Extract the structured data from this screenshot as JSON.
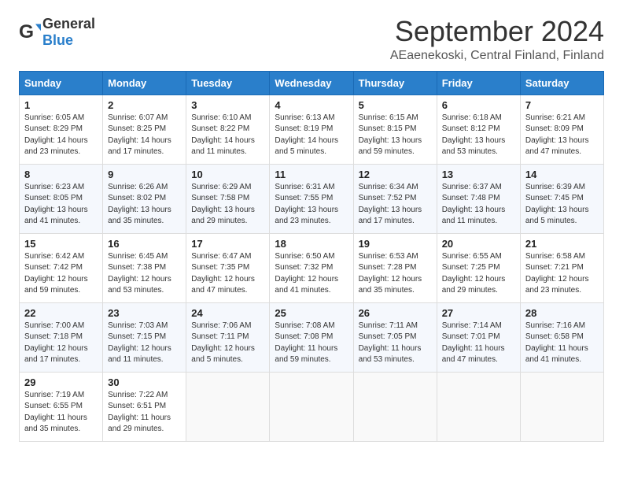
{
  "logo": {
    "text_general": "General",
    "text_blue": "Blue"
  },
  "title": "September 2024",
  "subtitle": "AEaenekoski, Central Finland, Finland",
  "days_of_week": [
    "Sunday",
    "Monday",
    "Tuesday",
    "Wednesday",
    "Thursday",
    "Friday",
    "Saturday"
  ],
  "weeks": [
    [
      {
        "day": "1",
        "sunrise": "Sunrise: 6:05 AM",
        "sunset": "Sunset: 8:29 PM",
        "daylight": "Daylight: 14 hours and 23 minutes."
      },
      {
        "day": "2",
        "sunrise": "Sunrise: 6:07 AM",
        "sunset": "Sunset: 8:25 PM",
        "daylight": "Daylight: 14 hours and 17 minutes."
      },
      {
        "day": "3",
        "sunrise": "Sunrise: 6:10 AM",
        "sunset": "Sunset: 8:22 PM",
        "daylight": "Daylight: 14 hours and 11 minutes."
      },
      {
        "day": "4",
        "sunrise": "Sunrise: 6:13 AM",
        "sunset": "Sunset: 8:19 PM",
        "daylight": "Daylight: 14 hours and 5 minutes."
      },
      {
        "day": "5",
        "sunrise": "Sunrise: 6:15 AM",
        "sunset": "Sunset: 8:15 PM",
        "daylight": "Daylight: 13 hours and 59 minutes."
      },
      {
        "day": "6",
        "sunrise": "Sunrise: 6:18 AM",
        "sunset": "Sunset: 8:12 PM",
        "daylight": "Daylight: 13 hours and 53 minutes."
      },
      {
        "day": "7",
        "sunrise": "Sunrise: 6:21 AM",
        "sunset": "Sunset: 8:09 PM",
        "daylight": "Daylight: 13 hours and 47 minutes."
      }
    ],
    [
      {
        "day": "8",
        "sunrise": "Sunrise: 6:23 AM",
        "sunset": "Sunset: 8:05 PM",
        "daylight": "Daylight: 13 hours and 41 minutes."
      },
      {
        "day": "9",
        "sunrise": "Sunrise: 6:26 AM",
        "sunset": "Sunset: 8:02 PM",
        "daylight": "Daylight: 13 hours and 35 minutes."
      },
      {
        "day": "10",
        "sunrise": "Sunrise: 6:29 AM",
        "sunset": "Sunset: 7:58 PM",
        "daylight": "Daylight: 13 hours and 29 minutes."
      },
      {
        "day": "11",
        "sunrise": "Sunrise: 6:31 AM",
        "sunset": "Sunset: 7:55 PM",
        "daylight": "Daylight: 13 hours and 23 minutes."
      },
      {
        "day": "12",
        "sunrise": "Sunrise: 6:34 AM",
        "sunset": "Sunset: 7:52 PM",
        "daylight": "Daylight: 13 hours and 17 minutes."
      },
      {
        "day": "13",
        "sunrise": "Sunrise: 6:37 AM",
        "sunset": "Sunset: 7:48 PM",
        "daylight": "Daylight: 13 hours and 11 minutes."
      },
      {
        "day": "14",
        "sunrise": "Sunrise: 6:39 AM",
        "sunset": "Sunset: 7:45 PM",
        "daylight": "Daylight: 13 hours and 5 minutes."
      }
    ],
    [
      {
        "day": "15",
        "sunrise": "Sunrise: 6:42 AM",
        "sunset": "Sunset: 7:42 PM",
        "daylight": "Daylight: 12 hours and 59 minutes."
      },
      {
        "day": "16",
        "sunrise": "Sunrise: 6:45 AM",
        "sunset": "Sunset: 7:38 PM",
        "daylight": "Daylight: 12 hours and 53 minutes."
      },
      {
        "day": "17",
        "sunrise": "Sunrise: 6:47 AM",
        "sunset": "Sunset: 7:35 PM",
        "daylight": "Daylight: 12 hours and 47 minutes."
      },
      {
        "day": "18",
        "sunrise": "Sunrise: 6:50 AM",
        "sunset": "Sunset: 7:32 PM",
        "daylight": "Daylight: 12 hours and 41 minutes."
      },
      {
        "day": "19",
        "sunrise": "Sunrise: 6:53 AM",
        "sunset": "Sunset: 7:28 PM",
        "daylight": "Daylight: 12 hours and 35 minutes."
      },
      {
        "day": "20",
        "sunrise": "Sunrise: 6:55 AM",
        "sunset": "Sunset: 7:25 PM",
        "daylight": "Daylight: 12 hours and 29 minutes."
      },
      {
        "day": "21",
        "sunrise": "Sunrise: 6:58 AM",
        "sunset": "Sunset: 7:21 PM",
        "daylight": "Daylight: 12 hours and 23 minutes."
      }
    ],
    [
      {
        "day": "22",
        "sunrise": "Sunrise: 7:00 AM",
        "sunset": "Sunset: 7:18 PM",
        "daylight": "Daylight: 12 hours and 17 minutes."
      },
      {
        "day": "23",
        "sunrise": "Sunrise: 7:03 AM",
        "sunset": "Sunset: 7:15 PM",
        "daylight": "Daylight: 12 hours and 11 minutes."
      },
      {
        "day": "24",
        "sunrise": "Sunrise: 7:06 AM",
        "sunset": "Sunset: 7:11 PM",
        "daylight": "Daylight: 12 hours and 5 minutes."
      },
      {
        "day": "25",
        "sunrise": "Sunrise: 7:08 AM",
        "sunset": "Sunset: 7:08 PM",
        "daylight": "Daylight: 11 hours and 59 minutes."
      },
      {
        "day": "26",
        "sunrise": "Sunrise: 7:11 AM",
        "sunset": "Sunset: 7:05 PM",
        "daylight": "Daylight: 11 hours and 53 minutes."
      },
      {
        "day": "27",
        "sunrise": "Sunrise: 7:14 AM",
        "sunset": "Sunset: 7:01 PM",
        "daylight": "Daylight: 11 hours and 47 minutes."
      },
      {
        "day": "28",
        "sunrise": "Sunrise: 7:16 AM",
        "sunset": "Sunset: 6:58 PM",
        "daylight": "Daylight: 11 hours and 41 minutes."
      }
    ],
    [
      {
        "day": "29",
        "sunrise": "Sunrise: 7:19 AM",
        "sunset": "Sunset: 6:55 PM",
        "daylight": "Daylight: 11 hours and 35 minutes."
      },
      {
        "day": "30",
        "sunrise": "Sunrise: 7:22 AM",
        "sunset": "Sunset: 6:51 PM",
        "daylight": "Daylight: 11 hours and 29 minutes."
      },
      null,
      null,
      null,
      null,
      null
    ]
  ]
}
